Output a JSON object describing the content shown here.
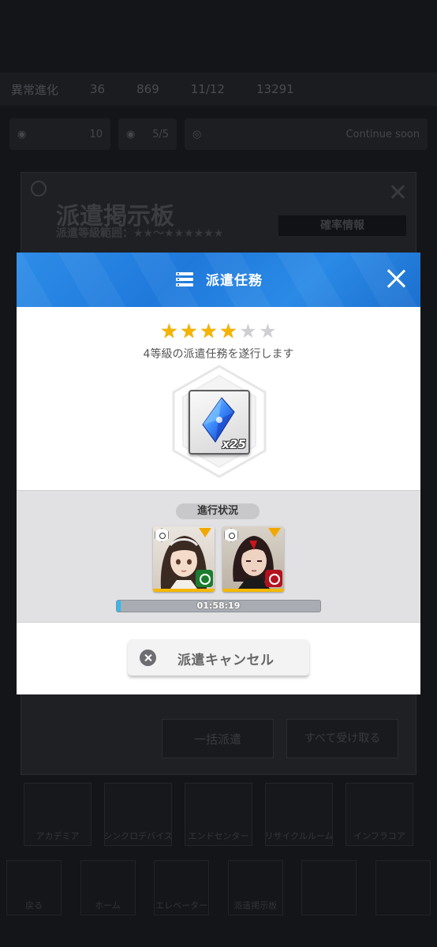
{
  "background": {
    "top_bar": [
      "異常進化",
      "36",
      "869",
      "11/12",
      "13291"
    ],
    "resources": [
      "10",
      "5/5",
      "Continue soon"
    ],
    "panel": {
      "title": "派遣掲示板",
      "subtitle": "派遣等級範囲：★★～★★★★★★",
      "rate_button": "確率情報"
    },
    "dispatch_all_button": "一括派遣",
    "receive_all_button": "すべて受け取る",
    "menu": [
      "アカデミア",
      "シンクロデバイス",
      "エンドセンター",
      "リサイクルルーム",
      "インフラコア"
    ],
    "bottom": [
      "戻る",
      "ホーム",
      "エレベーター",
      "派遣掲示板",
      "",
      ""
    ]
  },
  "modal": {
    "title": "派遣任務",
    "rating": {
      "filled": 4,
      "total": 6
    },
    "description": "4等級の派遣任務を遂行します",
    "reward": {
      "count_label": "x25"
    },
    "progress_label": "進行状況",
    "timer": "01:58:19",
    "progress_fraction": 0.02,
    "cancel_label": "派遣キャンセル"
  },
  "colors": {
    "header_blue": "#1f79db",
    "star_gold": "#f4b400",
    "progress_cyan": "#33b9ec",
    "element_green": "#1a7d2f",
    "element_red": "#b3121e"
  }
}
